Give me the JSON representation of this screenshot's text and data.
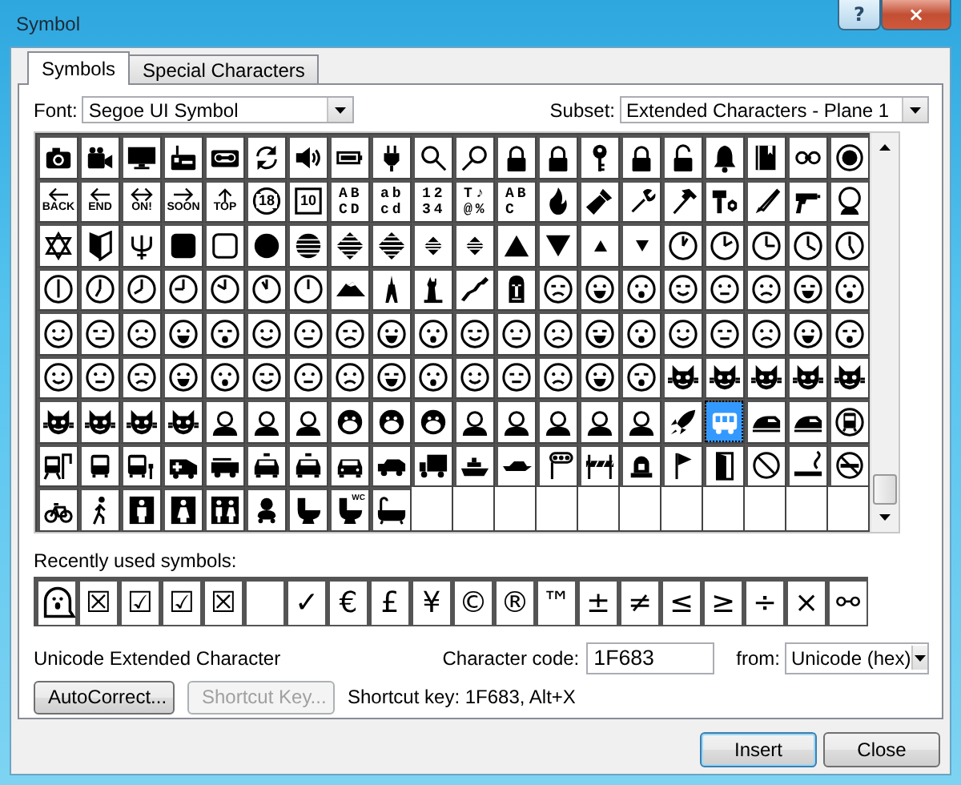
{
  "window": {
    "title": "Symbol",
    "help": "?",
    "close": "×"
  },
  "tabs": [
    {
      "label": "Symbols",
      "selected": true
    },
    {
      "label": "Special Characters",
      "selected": false
    }
  ],
  "font": {
    "label": "Font:",
    "value": "Segoe UI Symbol"
  },
  "subset": {
    "label": "Subset:",
    "value": "Extended Characters - Plane 1"
  },
  "symbol_grid": {
    "rows": [
      [
        {
          "kind": "symbol",
          "selected": false
        },
        {
          "kind": "symbol",
          "selected": false
        },
        {
          "kind": "symbol",
          "selected": false
        },
        {
          "kind": "symbol",
          "selected": false
        },
        {
          "kind": "symbol",
          "selected": false
        },
        {
          "kind": "symbol",
          "selected": false
        },
        {
          "kind": "symbol",
          "selected": false
        },
        {
          "kind": "symbol",
          "selected": false
        },
        {
          "kind": "symbol",
          "selected": false
        },
        {
          "kind": "symbol",
          "selected": false
        },
        {
          "kind": "symbol",
          "selected": false
        },
        {
          "kind": "symbol",
          "selected": false
        },
        {
          "kind": "symbol",
          "selected": false
        },
        {
          "kind": "symbol",
          "selected": false
        },
        {
          "kind": "symbol",
          "selected": false
        },
        {
          "kind": "symbol",
          "selected": false
        },
        {
          "kind": "symbol",
          "selected": false
        },
        {
          "kind": "symbol",
          "selected": false
        },
        {
          "kind": "symbol",
          "selected": false
        },
        {
          "kind": "symbol",
          "selected": false
        }
      ],
      [
        {
          "kind": "labeled",
          "label": "BACK",
          "selected": false
        },
        {
          "kind": "labeled",
          "label": "END",
          "selected": false
        },
        {
          "kind": "labeled",
          "label": "ON!",
          "selected": false
        },
        {
          "kind": "labeled",
          "label": "SOON",
          "selected": false
        },
        {
          "kind": "labeled",
          "label": "TOP",
          "selected": false
        },
        {
          "kind": "circled",
          "label": "18",
          "selected": false
        },
        {
          "kind": "circled",
          "label": "10",
          "selected": false
        },
        {
          "kind": "letters",
          "label": "ABCD",
          "selected": false
        },
        {
          "kind": "letters",
          "label": "abcd",
          "selected": false
        },
        {
          "kind": "letters",
          "label": "1234",
          "selected": false
        },
        {
          "kind": "letters",
          "label": "T♪@%",
          "selected": false
        },
        {
          "kind": "letters",
          "label": "ABC",
          "selected": false
        },
        {
          "kind": "symbol",
          "selected": false
        },
        {
          "kind": "symbol",
          "selected": false
        },
        {
          "kind": "symbol",
          "selected": false
        },
        {
          "kind": "symbol",
          "selected": false
        },
        {
          "kind": "symbol",
          "selected": false
        },
        {
          "kind": "symbol",
          "selected": false
        },
        {
          "kind": "symbol",
          "selected": false
        },
        {
          "kind": "symbol",
          "selected": false
        }
      ],
      [
        {
          "kind": "symbol",
          "selected": false
        },
        {
          "kind": "symbol",
          "selected": false
        },
        {
          "kind": "symbol",
          "selected": false
        },
        {
          "kind": "symbol",
          "selected": false
        },
        {
          "kind": "symbol",
          "selected": false
        },
        {
          "kind": "symbol",
          "selected": false
        },
        {
          "kind": "symbol",
          "selected": false
        },
        {
          "kind": "symbol",
          "selected": false
        },
        {
          "kind": "symbol",
          "selected": false
        },
        {
          "kind": "symbol",
          "selected": false
        },
        {
          "kind": "symbol",
          "selected": false
        },
        {
          "kind": "symbol",
          "selected": false
        },
        {
          "kind": "symbol",
          "selected": false
        },
        {
          "kind": "symbol",
          "selected": false
        },
        {
          "kind": "symbol",
          "selected": false
        },
        {
          "kind": "symbol",
          "selected": false
        },
        {
          "kind": "symbol",
          "selected": false
        },
        {
          "kind": "symbol",
          "selected": false
        },
        {
          "kind": "symbol",
          "selected": false
        },
        {
          "kind": "symbol",
          "selected": false
        }
      ],
      [
        {
          "kind": "symbol",
          "selected": false
        },
        {
          "kind": "symbol",
          "selected": false
        },
        {
          "kind": "symbol",
          "selected": false
        },
        {
          "kind": "symbol",
          "selected": false
        },
        {
          "kind": "symbol",
          "selected": false
        },
        {
          "kind": "symbol",
          "selected": false
        },
        {
          "kind": "symbol",
          "selected": false
        },
        {
          "kind": "symbol",
          "selected": false
        },
        {
          "kind": "symbol",
          "selected": false
        },
        {
          "kind": "symbol",
          "selected": false
        },
        {
          "kind": "symbol",
          "selected": false
        },
        {
          "kind": "symbol",
          "selected": false
        },
        {
          "kind": "symbol",
          "selected": false
        },
        {
          "kind": "symbol",
          "selected": false
        },
        {
          "kind": "symbol",
          "selected": false
        },
        {
          "kind": "symbol",
          "selected": false
        },
        {
          "kind": "symbol",
          "selected": false
        },
        {
          "kind": "symbol",
          "selected": false
        },
        {
          "kind": "symbol",
          "selected": false
        },
        {
          "kind": "symbol",
          "selected": false
        }
      ],
      [
        {
          "kind": "symbol",
          "selected": false
        },
        {
          "kind": "symbol",
          "selected": false
        },
        {
          "kind": "symbol",
          "selected": false
        },
        {
          "kind": "symbol",
          "selected": false
        },
        {
          "kind": "symbol",
          "selected": false
        },
        {
          "kind": "symbol",
          "selected": false
        },
        {
          "kind": "symbol",
          "selected": false
        },
        {
          "kind": "symbol",
          "selected": false
        },
        {
          "kind": "symbol",
          "selected": false
        },
        {
          "kind": "symbol",
          "selected": false
        },
        {
          "kind": "symbol",
          "selected": false
        },
        {
          "kind": "symbol",
          "selected": false
        },
        {
          "kind": "symbol",
          "selected": false
        },
        {
          "kind": "symbol",
          "selected": false
        },
        {
          "kind": "symbol",
          "selected": false
        },
        {
          "kind": "symbol",
          "selected": false
        },
        {
          "kind": "symbol",
          "selected": false
        },
        {
          "kind": "symbol",
          "selected": false
        },
        {
          "kind": "symbol",
          "selected": false
        },
        {
          "kind": "symbol",
          "selected": false
        }
      ],
      [
        {
          "kind": "symbol",
          "selected": false
        },
        {
          "kind": "symbol",
          "selected": false
        },
        {
          "kind": "symbol",
          "selected": false
        },
        {
          "kind": "symbol",
          "selected": false
        },
        {
          "kind": "symbol",
          "selected": false
        },
        {
          "kind": "symbol",
          "selected": false
        },
        {
          "kind": "symbol",
          "selected": false
        },
        {
          "kind": "symbol",
          "selected": false
        },
        {
          "kind": "symbol",
          "selected": false
        },
        {
          "kind": "symbol",
          "selected": false
        },
        {
          "kind": "symbol",
          "selected": false
        },
        {
          "kind": "symbol",
          "selected": false
        },
        {
          "kind": "symbol",
          "selected": false
        },
        {
          "kind": "symbol",
          "selected": false
        },
        {
          "kind": "symbol",
          "selected": false
        },
        {
          "kind": "symbol",
          "selected": false
        },
        {
          "kind": "symbol",
          "selected": false
        },
        {
          "kind": "symbol",
          "selected": false
        },
        {
          "kind": "symbol",
          "selected": false
        },
        {
          "kind": "symbol",
          "selected": false
        }
      ],
      [
        {
          "kind": "symbol",
          "selected": false
        },
        {
          "kind": "symbol",
          "selected": false
        },
        {
          "kind": "symbol",
          "selected": false
        },
        {
          "kind": "symbol",
          "selected": false
        },
        {
          "kind": "symbol",
          "selected": false
        },
        {
          "kind": "symbol",
          "selected": false
        },
        {
          "kind": "symbol",
          "selected": false
        },
        {
          "kind": "symbol",
          "selected": false
        },
        {
          "kind": "symbol",
          "selected": false
        },
        {
          "kind": "symbol",
          "selected": false
        },
        {
          "kind": "symbol",
          "selected": false
        },
        {
          "kind": "symbol",
          "selected": false
        },
        {
          "kind": "symbol",
          "selected": false
        },
        {
          "kind": "symbol",
          "selected": false
        },
        {
          "kind": "symbol",
          "selected": false
        },
        {
          "kind": "symbol",
          "selected": false
        },
        {
          "kind": "symbol",
          "selected": true
        },
        {
          "kind": "symbol",
          "selected": false
        },
        {
          "kind": "symbol",
          "selected": false
        },
        {
          "kind": "symbol",
          "selected": false
        }
      ],
      [
        {
          "kind": "symbol",
          "selected": false
        },
        {
          "kind": "symbol",
          "selected": false
        },
        {
          "kind": "symbol",
          "selected": false
        },
        {
          "kind": "symbol",
          "selected": false
        },
        {
          "kind": "symbol",
          "selected": false
        },
        {
          "kind": "symbol",
          "selected": false
        },
        {
          "kind": "symbol",
          "selected": false
        },
        {
          "kind": "symbol",
          "selected": false
        },
        {
          "kind": "symbol",
          "selected": false
        },
        {
          "kind": "symbol",
          "selected": false
        },
        {
          "kind": "symbol",
          "selected": false
        },
        {
          "kind": "symbol",
          "selected": false
        },
        {
          "kind": "symbol",
          "selected": false
        },
        {
          "kind": "symbol",
          "selected": false
        },
        {
          "kind": "symbol",
          "selected": false
        },
        {
          "kind": "symbol",
          "selected": false
        },
        {
          "kind": "symbol",
          "selected": false
        },
        {
          "kind": "symbol",
          "selected": false
        },
        {
          "kind": "symbol",
          "selected": false
        },
        {
          "kind": "symbol",
          "selected": false
        }
      ],
      [
        {
          "kind": "symbol",
          "selected": false
        },
        {
          "kind": "symbol",
          "selected": false
        },
        {
          "kind": "symbol",
          "selected": false
        },
        {
          "kind": "symbol",
          "selected": false
        },
        {
          "kind": "symbol",
          "selected": false
        },
        {
          "kind": "symbol",
          "selected": false
        },
        {
          "kind": "symbol",
          "selected": false
        },
        {
          "kind": "tagged",
          "label": "WC",
          "selected": false
        },
        {
          "kind": "symbol",
          "selected": false
        },
        {
          "kind": "empty"
        },
        {
          "kind": "empty"
        },
        {
          "kind": "empty"
        },
        {
          "kind": "empty"
        },
        {
          "kind": "empty"
        },
        {
          "kind": "empty"
        },
        {
          "kind": "empty"
        },
        {
          "kind": "empty"
        },
        {
          "kind": "empty"
        },
        {
          "kind": "empty"
        },
        {
          "kind": "empty"
        }
      ]
    ]
  },
  "recent": {
    "label": "Recently used symbols:",
    "symbols": [
      {
        "kind": "icon"
      },
      {
        "kind": "glyph",
        "char": "☒"
      },
      {
        "kind": "glyph",
        "char": "☑"
      },
      {
        "kind": "glyph",
        "char": "☑"
      },
      {
        "kind": "glyph",
        "char": "☒"
      },
      {
        "kind": "blank"
      },
      {
        "kind": "glyph",
        "char": "✓"
      },
      {
        "kind": "glyph",
        "char": "€"
      },
      {
        "kind": "glyph",
        "char": "£"
      },
      {
        "kind": "glyph",
        "char": "¥"
      },
      {
        "kind": "glyph",
        "char": "©"
      },
      {
        "kind": "glyph",
        "char": "®"
      },
      {
        "kind": "glyph",
        "char": "™"
      },
      {
        "kind": "glyph",
        "char": "±"
      },
      {
        "kind": "glyph",
        "char": "≠"
      },
      {
        "kind": "glyph",
        "char": "≤"
      },
      {
        "kind": "glyph",
        "char": "≥"
      },
      {
        "kind": "glyph",
        "char": "÷"
      },
      {
        "kind": "glyph",
        "char": "×"
      },
      {
        "kind": "glyph",
        "char": "⚯"
      }
    ]
  },
  "description": "Unicode Extended Character",
  "character_code": {
    "label": "Character code:",
    "value": "1F683"
  },
  "from": {
    "label": "from:",
    "value": "Unicode (hex)"
  },
  "autocorrect_button": {
    "label": "AutoCorrect...",
    "disabled": false
  },
  "shortcut_button": {
    "label": "Shortcut Key...",
    "disabled": true
  },
  "shortcut_key": "Shortcut key: 1F683, Alt+X",
  "buttons": [
    {
      "label": "Insert",
      "default": true
    },
    {
      "label": "Close",
      "default": false
    }
  ]
}
